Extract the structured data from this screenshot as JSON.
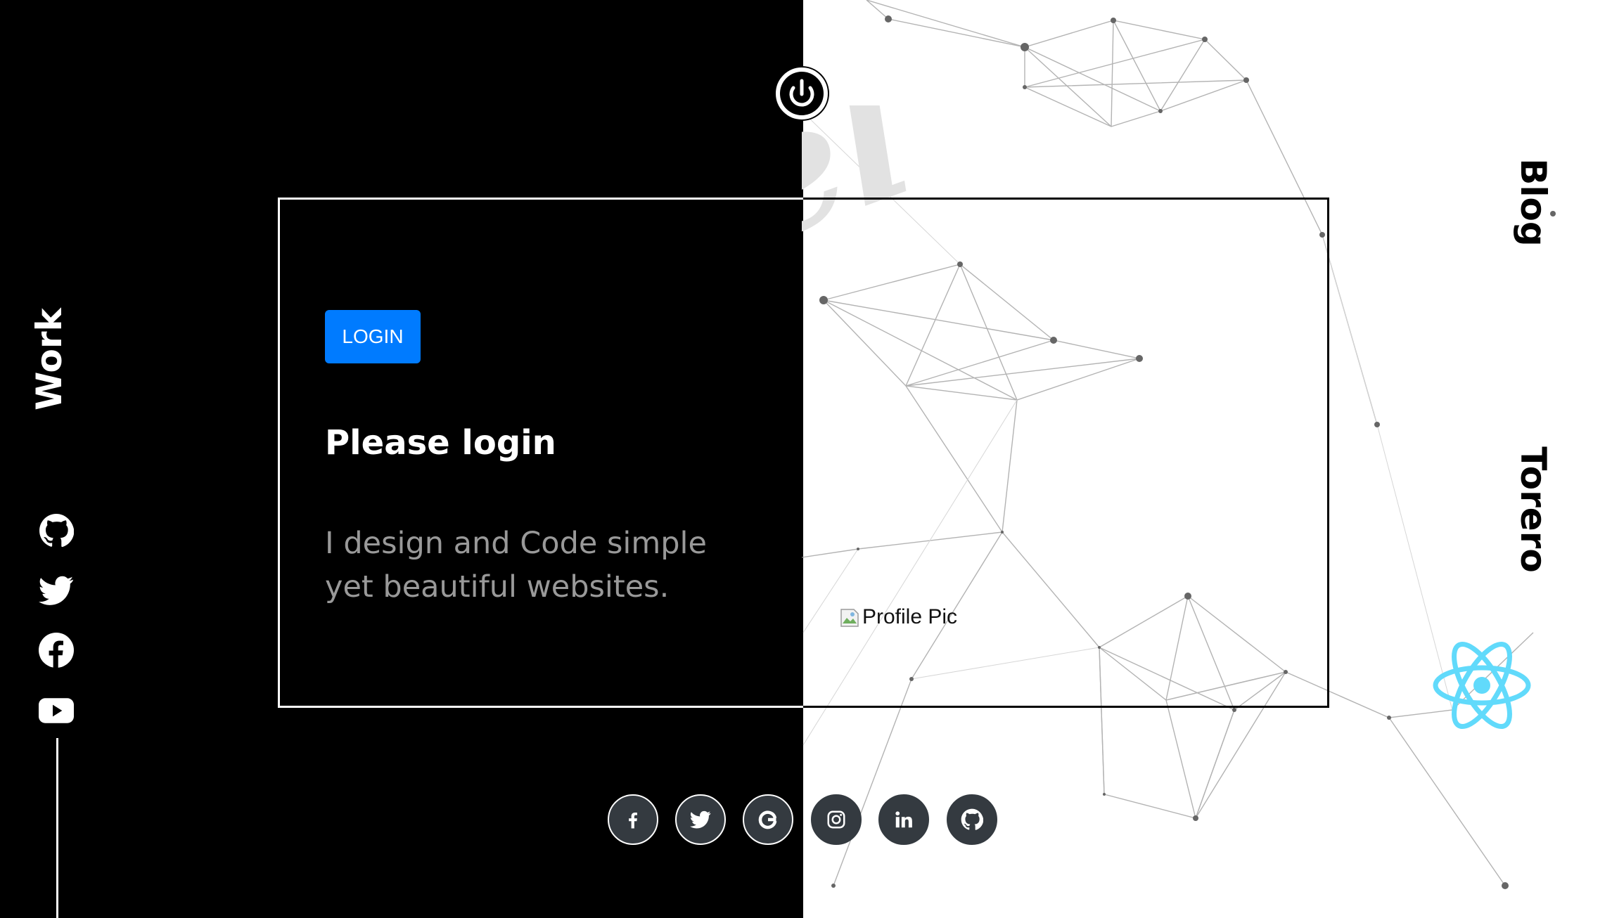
{
  "nav": {
    "work_label": "Work",
    "blog_label": "Blog",
    "torero_label": "Torero"
  },
  "watermark_text": "el",
  "card": {
    "login_label": "LOGIN",
    "title": "Please login",
    "description": "I design and Code simple yet beautiful websites.",
    "profile_alt": "Profile Pic"
  },
  "side_social_icons": [
    "github-icon",
    "twitter-icon",
    "facebook-icon",
    "youtube-icon"
  ],
  "bottom_social_icons": [
    "facebook-icon",
    "twitter-icon",
    "google-icon",
    "instagram-icon",
    "linkedin-icon",
    "github-icon"
  ],
  "colors": {
    "dark_bg": "#000000",
    "light_bg": "#ffffff",
    "accent": "#007bff",
    "react": "#61dafb",
    "social_bg": "#343a40"
  }
}
